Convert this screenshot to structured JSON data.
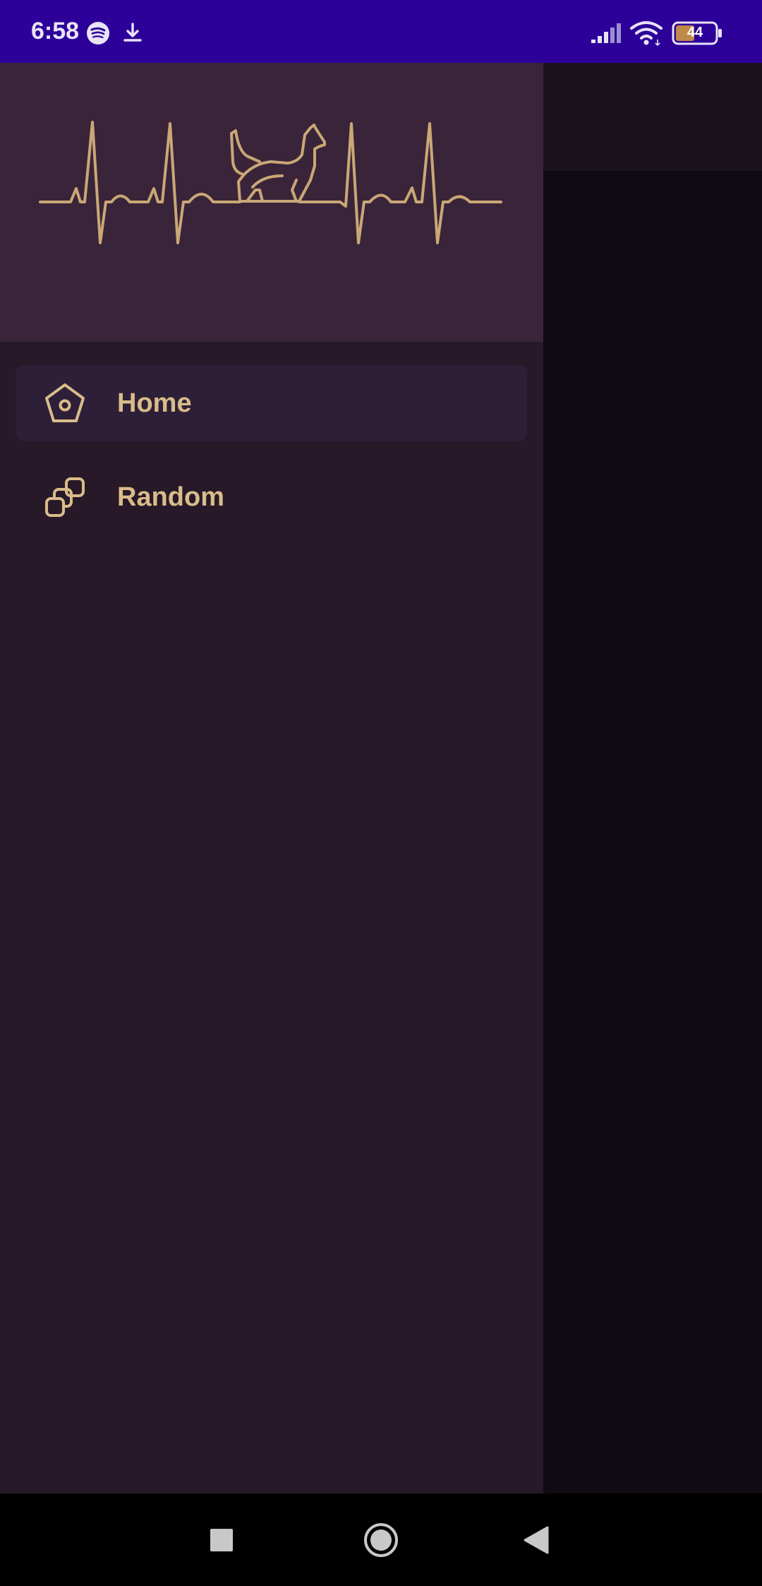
{
  "status_bar": {
    "time": "6:58",
    "battery": "44",
    "icons": [
      "spotify-icon",
      "download-icon",
      "signal-icon",
      "wifi-icon",
      "battery-icon"
    ]
  },
  "drawer": {
    "header_art": "heartbeat-dog-logo",
    "items": [
      {
        "label": "Home",
        "icon": "home-pentagon-icon",
        "selected": true
      },
      {
        "label": "Random",
        "icon": "random-squares-icon",
        "selected": false
      }
    ]
  },
  "navigation_bar": {
    "buttons": [
      "recents-button",
      "home-button",
      "back-button"
    ]
  },
  "colors": {
    "status_bar": "#2d0099",
    "drawer_header": "#3a2439",
    "drawer_body": "#271928",
    "selected_item": "#2e1f38",
    "accent": "#d9bc8a",
    "scrim": "#100a12"
  }
}
